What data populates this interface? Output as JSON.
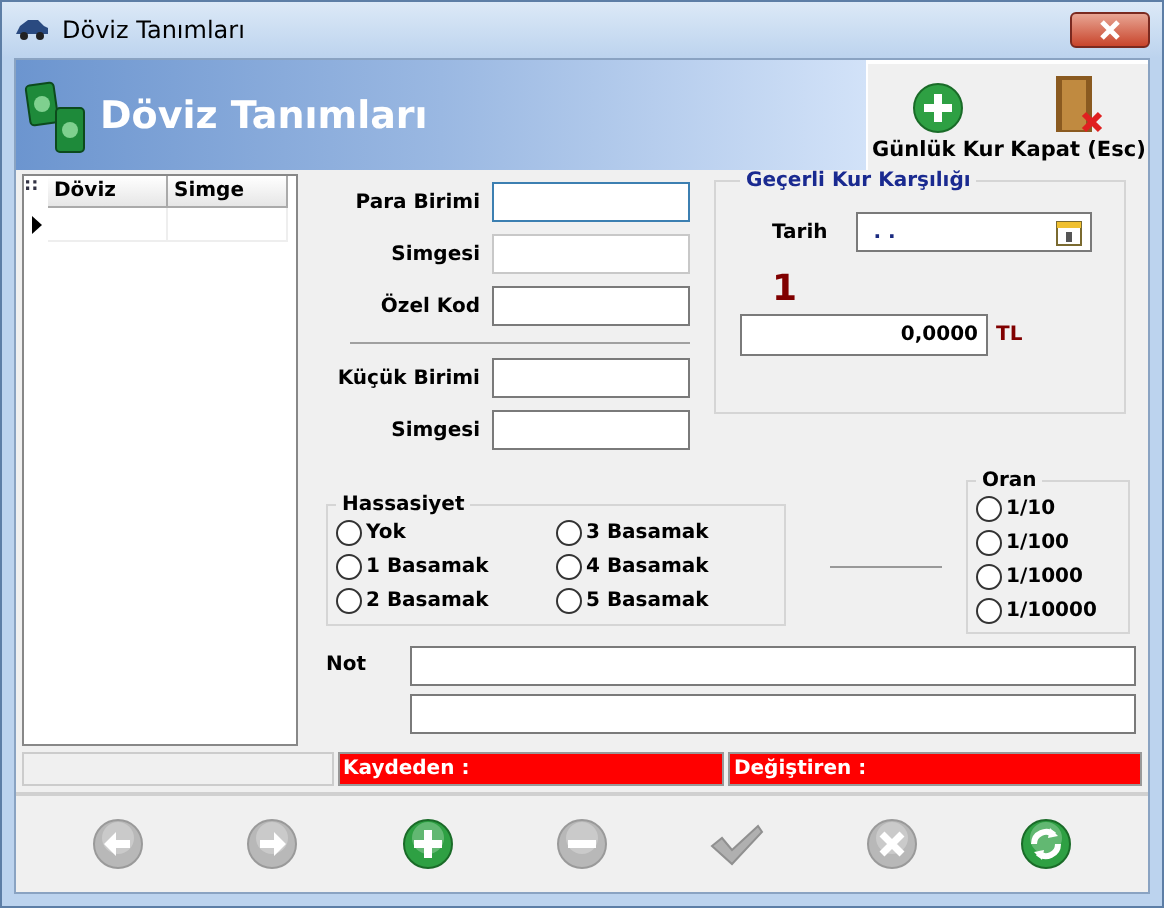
{
  "window": {
    "title": "Döviz Tanımları"
  },
  "header": {
    "title": "Döviz Tanımları",
    "tools": [
      {
        "kind": "add",
        "label": "Günlük Kur"
      },
      {
        "kind": "exit",
        "label": "Kapat (Esc)"
      }
    ]
  },
  "grid": {
    "corner": "::",
    "columns": [
      "Döviz",
      "Simge"
    ],
    "rows": [
      {
        "cells": [
          "",
          ""
        ],
        "selected": true
      }
    ]
  },
  "form": {
    "main_fields": [
      {
        "label": "Para Birimi",
        "focused": true,
        "disabled": false
      },
      {
        "label": "Simgesi",
        "focused": false,
        "disabled": true
      },
      {
        "label": "Özel Kod",
        "focused": false,
        "disabled": false
      }
    ],
    "sub_fields": [
      {
        "label": "Küçük Birimi",
        "focused": false,
        "disabled": false
      },
      {
        "label": "Simgesi",
        "focused": false,
        "disabled": false
      }
    ],
    "precision": {
      "title": "Hassasiyet",
      "options": [
        {
          "label": "Yok",
          "selected": false
        },
        {
          "label": "1 Basamak",
          "selected": false
        },
        {
          "label": "2 Basamak",
          "selected": false
        },
        {
          "label": "3 Basamak",
          "selected": false
        },
        {
          "label": "4 Basamak",
          "selected": false
        },
        {
          "label": "5 Basamak",
          "selected": false
        }
      ]
    },
    "rate": {
      "title": "Geçerli Kur Karşılığı",
      "date_label": "Tarih",
      "date_value": ". .",
      "unit_amount": "1",
      "value": "0,0000",
      "currency": "TL"
    },
    "ratio": {
      "title": "Oran",
      "options": [
        {
          "label": "1/10",
          "selected": false
        },
        {
          "label": "1/100",
          "selected": false
        },
        {
          "label": "1/1000",
          "selected": false
        },
        {
          "label": "1/10000",
          "selected": false
        }
      ]
    },
    "note_label": "Not"
  },
  "status_bar": {
    "created_by": "Kaydeden :",
    "modified_by": "Değiştiren :"
  },
  "toolbar": [
    {
      "kind": "prev",
      "disabled": true
    },
    {
      "kind": "next",
      "disabled": true
    },
    {
      "kind": "add",
      "disabled": false
    },
    {
      "kind": "remove",
      "disabled": true
    },
    {
      "kind": "confirm",
      "disabled": true
    },
    {
      "kind": "cancel",
      "disabled": true
    },
    {
      "kind": "refresh",
      "disabled": false
    }
  ]
}
